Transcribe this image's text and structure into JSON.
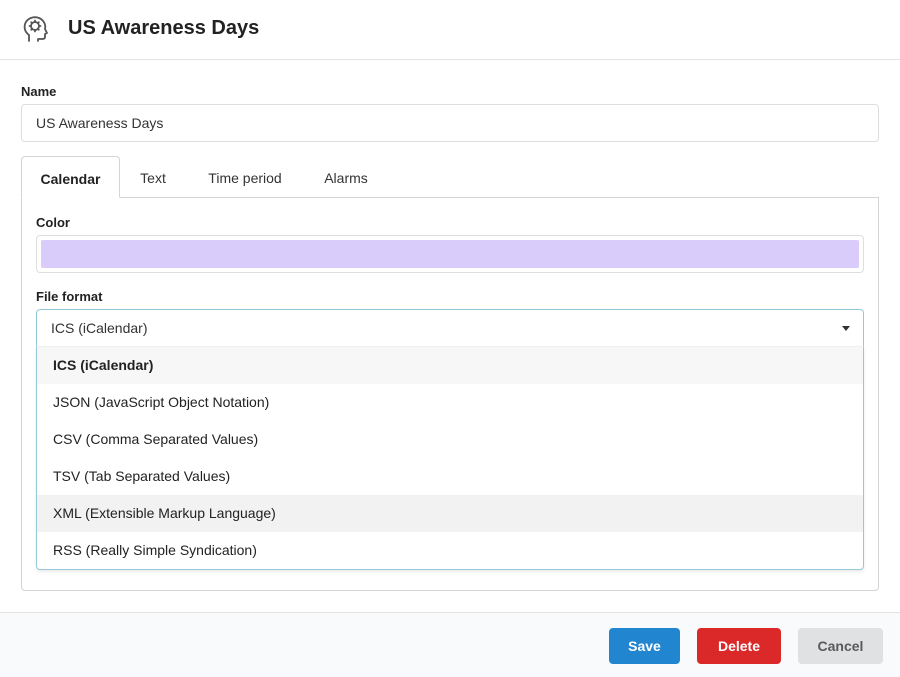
{
  "header": {
    "title": "US Awareness Days",
    "icon": "head-brain-icon"
  },
  "form": {
    "name_label": "Name",
    "name_value": "US Awareness Days"
  },
  "tabs": [
    {
      "label": "Calendar",
      "active": true
    },
    {
      "label": "Text",
      "active": false
    },
    {
      "label": "Time period",
      "active": false
    },
    {
      "label": "Alarms",
      "active": false
    }
  ],
  "calendar": {
    "color_label": "Color",
    "color_value": "#d9ccfb",
    "file_format_label": "File format",
    "file_format_selected": "ICS (iCalendar)",
    "file_format_options": [
      "ICS (iCalendar)",
      "JSON (JavaScript Object Notation)",
      "CSV (Comma Separated Values)",
      "TSV (Tab Separated Values)",
      "XML (Extensible Markup Language)",
      "RSS (Really Simple Syndication)"
    ]
  },
  "footer": {
    "save_label": "Save",
    "delete_label": "Delete",
    "cancel_label": "Cancel"
  },
  "colors": {
    "primary": "#2185d0",
    "danger": "#db2828",
    "neutral": "#e0e1e2",
    "focus_border": "#96c8da"
  }
}
